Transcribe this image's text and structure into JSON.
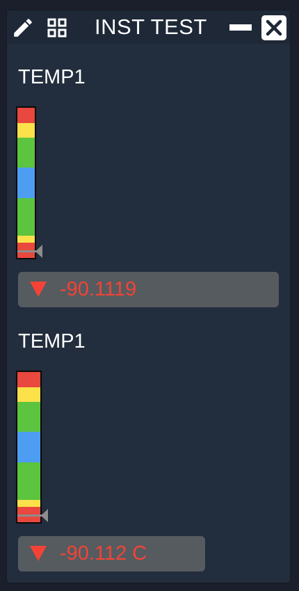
{
  "window": {
    "title": "INST TEST",
    "icons": [
      "pencil-icon",
      "grid-icon",
      "minimize-icon",
      "close-icon"
    ]
  },
  "widgets": [
    {
      "label": "TEMP1",
      "value": "-90.1119",
      "trend": "down",
      "level": 0.0
    },
    {
      "label": "TEMP1",
      "value": "-90.112 C",
      "trend": "down",
      "level": 0.0
    }
  ],
  "colors": {
    "red": "#e8483e",
    "yellow": "#fbe14a",
    "green": "#5cc43f",
    "blue": "#4d9df2",
    "value_text": "#f44336",
    "value_box": "#565b60"
  }
}
